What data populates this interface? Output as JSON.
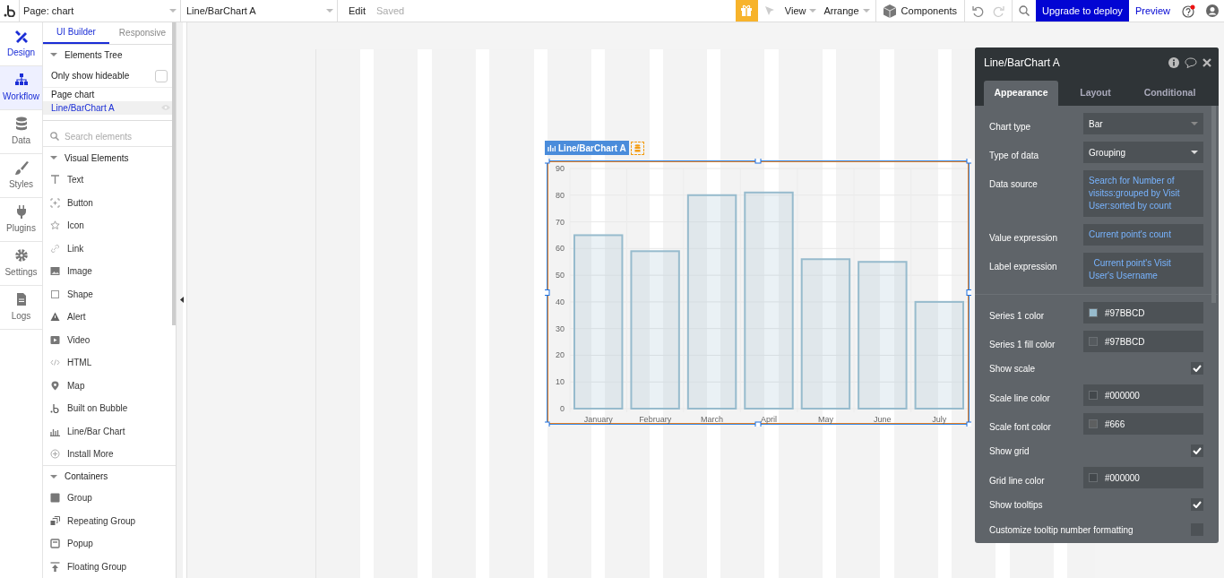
{
  "top_bar": {
    "page_select": "Page: chart",
    "element_select": "Line/BarChart A",
    "edit": "Edit",
    "saved": "Saved",
    "view": "View",
    "arrange": "Arrange",
    "components": "Components",
    "upgrade": "Upgrade to deploy",
    "preview": "Preview",
    "help_alert": true
  },
  "rail": [
    {
      "label": "Design",
      "active": true,
      "highlighted": false
    },
    {
      "label": "Workflow",
      "active": true,
      "highlighted": true
    },
    {
      "label": "Data",
      "active": false,
      "highlighted": false
    },
    {
      "label": "Styles",
      "active": false,
      "highlighted": false
    },
    {
      "label": "Plugins",
      "active": false,
      "highlighted": false
    },
    {
      "label": "Settings",
      "active": false,
      "highlighted": false
    },
    {
      "label": "Logs",
      "active": false,
      "highlighted": false
    }
  ],
  "panel": {
    "tabs": [
      {
        "label": "UI Builder",
        "selected": true
      },
      {
        "label": "Responsive",
        "selected": false
      }
    ],
    "tree_header": {
      "label": "Elements Tree",
      "expanded": true
    },
    "hideable": {
      "label": "Only show hideable",
      "checked": false
    },
    "tree": [
      {
        "label": "Page chart",
        "selected": false,
        "children": [
          {
            "label": "Line/BarChart A",
            "selected": true
          }
        ]
      }
    ],
    "search": {
      "placeholder": "Search elements"
    },
    "sections": [
      {
        "label": "Visual Elements",
        "expanded": true,
        "items": [
          "Text",
          "Button",
          "Icon",
          "Link",
          "Image",
          "Shape",
          "Alert",
          "Video",
          "HTML",
          "Map",
          "Built on Bubble",
          "Line/Bar Chart",
          "Install More"
        ]
      },
      {
        "label": "Containers",
        "expanded": true,
        "items": [
          "Group",
          "Repeating Group",
          "Popup",
          "Floating Group"
        ]
      }
    ]
  },
  "element_tag": "Line/BarChart A",
  "chart_data": {
    "type": "bar",
    "categories": [
      "January",
      "February",
      "March",
      "April",
      "May",
      "June",
      "July"
    ],
    "series": [
      {
        "color": "#97bbcd",
        "values": [
          65,
          59,
          80,
          81,
          56,
          55,
          40
        ]
      }
    ],
    "grid": true,
    "ylim": [
      0,
      90
    ],
    "yticks": [
      0,
      10,
      20,
      30,
      40,
      50,
      60,
      70,
      80,
      90
    ]
  },
  "inspector": {
    "title": "Line/BarChart A",
    "tabs": [
      {
        "label": "Appearance",
        "selected": true
      },
      {
        "label": "Layout",
        "selected": false
      },
      {
        "label": "Conditional",
        "selected": false
      }
    ],
    "groups": [
      [
        {
          "kind": "select",
          "label": "Chart type",
          "value": "Bar",
          "disabled": true
        },
        {
          "kind": "select",
          "label": "Type of data",
          "value": "Grouping",
          "disabled": false
        },
        {
          "kind": "expression",
          "label": "Data source",
          "value": "Search for Number of visitss:grouped by Visit User:sorted by count"
        },
        {
          "kind": "expression",
          "label": "Value expression",
          "value": "Current point's count"
        },
        {
          "kind": "expression",
          "label": "Label expression",
          "value": "  Current point's Visit User's Username"
        }
      ],
      [
        {
          "kind": "color",
          "label": "Series 1 color",
          "value": "#97BBCD",
          "color": "#97bbcd"
        },
        {
          "kind": "color",
          "label": "Series 1 fill color",
          "value": "#97BBCD",
          "color": "#555a5e"
        },
        {
          "kind": "check",
          "label": "Show scale",
          "checked": true
        },
        {
          "kind": "color",
          "label": "Scale line color",
          "value": "#000000",
          "color": "#43484c"
        },
        {
          "kind": "color",
          "label": "Scale font color",
          "value": "#666",
          "color": "#5d5f60"
        },
        {
          "kind": "check",
          "label": "Show grid",
          "checked": true
        },
        {
          "kind": "color",
          "label": "Grid line color",
          "value": "#000000",
          "color": "#43484c"
        },
        {
          "kind": "check",
          "label": "Show tooltips",
          "checked": true
        },
        {
          "kind": "check",
          "label": "Customize tooltip number formatting",
          "checked": false
        }
      ]
    ]
  }
}
